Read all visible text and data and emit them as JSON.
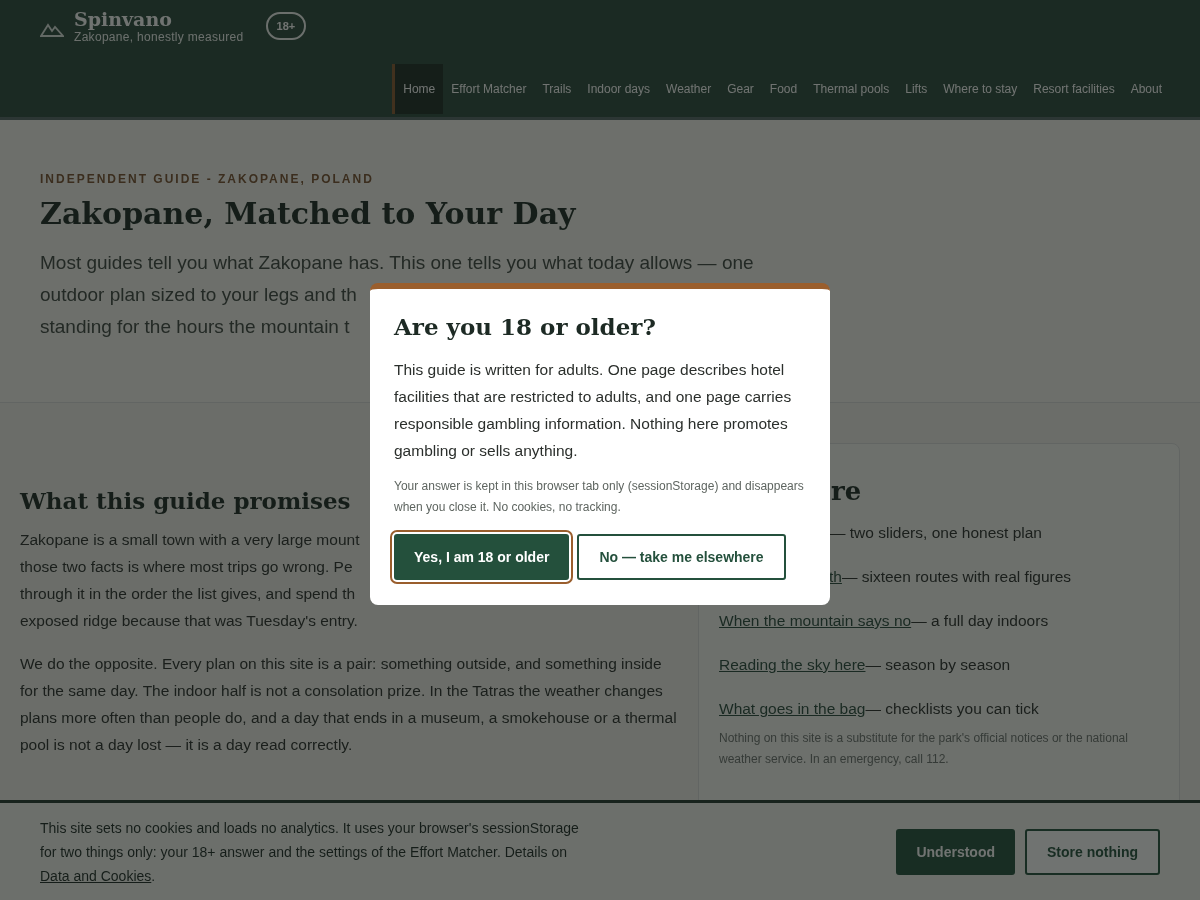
{
  "header": {
    "brand": {
      "name": "Spinvano",
      "tagline": "Zakopane, honestly measured"
    },
    "age_badge": "18+",
    "nav": [
      {
        "label": "Home",
        "selected": true
      },
      {
        "label": "Effort Matcher",
        "selected": false
      },
      {
        "label": "Trails",
        "selected": false
      },
      {
        "label": "Indoor days",
        "selected": false
      },
      {
        "label": "Weather",
        "selected": false
      },
      {
        "label": "Gear",
        "selected": false
      },
      {
        "label": "Food",
        "selected": false
      },
      {
        "label": "Thermal pools",
        "selected": false
      },
      {
        "label": "Lifts",
        "selected": false
      },
      {
        "label": "Where to stay",
        "selected": false
      },
      {
        "label": "Resort facilities",
        "selected": false
      },
      {
        "label": "About",
        "selected": false
      }
    ]
  },
  "hero": {
    "eyebrow": "INDEPENDENT GUIDE - ZAKOPANE, POLAND",
    "title": "Zakopane, Matched to Your Day",
    "intro_lines": [
      "Most guides tell you what Zakopane has. This one tells you what today allows — one",
      "outdoor plan sized to your legs and th",
      "standing for the hours the mountain t"
    ]
  },
  "main": {
    "heading": "What this guide promises",
    "paragraph_1_lines": [
      "Zakopane is a small town with a very large mount",
      "those two facts is where most trips go wrong. Pe",
      "through it in the order the list gives, and spend th",
      "exposed ridge because that was Tuesday's entry."
    ],
    "paragraph_2": "We do the opposite. Every plan on this site is a pair: something outside, and something inside for the same day. The indoor half is not a consolation prize. In the Tatras the weather changes plans more often than people do, and a day that ends in a museum, a smokehouse or a thermal pool is not a day lost — it is a day read correctly."
  },
  "aside": {
    "heading": "re",
    "items": [
      {
        "rest": "— two sliders, one honest plan"
      },
      {
        "link": "th",
        "rest": "— sixteen routes with real figures"
      },
      {
        "link": "When the mountain says no",
        "rest": "— a full day indoors"
      },
      {
        "link": "Reading the sky here",
        "rest": "— season by season"
      },
      {
        "link": "What goes in the bag",
        "rest": "— checklists you can tick"
      }
    ],
    "note": "Nothing on this site is a substitute for the park's official notices or the national weather service. In an emergency, call 112."
  },
  "modal": {
    "title": "Are you 18 or older?",
    "body": "This guide is written for adults. One page describes hotel facilities that are restricted to adults, and one page carries responsible gambling information. Nothing here promotes gambling or sells anything.",
    "note": "Your answer is kept in this browser tab only (sessionStorage) and disappears when you close it. No cookies, no tracking.",
    "buttons": [
      {
        "label": "Yes, I am 18 or older",
        "kind": "primary",
        "focused": true
      },
      {
        "label": "No — take me elsewhere",
        "kind": "secondary",
        "focused": false
      }
    ]
  },
  "cookie_bar": {
    "text": "This site sets no cookies and loads no analytics. It uses your browser's sessionStorage for two things only: your 18+ answer and the settings of the Effort Matcher. Details on ",
    "link": "Data and Cookies",
    "after": ".",
    "buttons": [
      {
        "label": "Understood",
        "kind": "primary"
      },
      {
        "label": "Store nothing",
        "kind": "secondary"
      }
    ]
  }
}
